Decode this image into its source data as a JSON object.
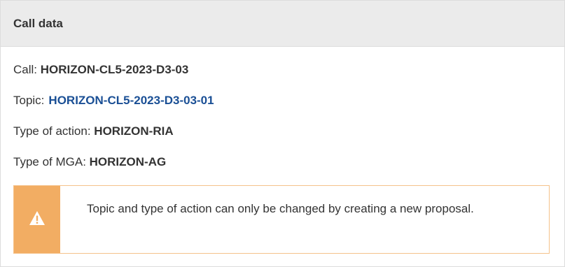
{
  "panel": {
    "title": "Call data"
  },
  "call": {
    "label": "Call: ",
    "value": "HORIZON-CL5-2023-D3-03"
  },
  "topic": {
    "label": "Topic:",
    "value": "HORIZON-CL5-2023-D3-03-01"
  },
  "type_of_action": {
    "label": "Type of action: ",
    "value": "HORIZON-RIA"
  },
  "type_of_mga": {
    "label": "Type of MGA: ",
    "value": "HORIZON-AG"
  },
  "alert": {
    "icon": "warning-icon",
    "text": "Topic and type of action can only be changed by creating a new proposal.",
    "accent_color": "#f2ad63"
  },
  "colors": {
    "link": "#1a4f95",
    "header_bg": "#ebebeb"
  }
}
